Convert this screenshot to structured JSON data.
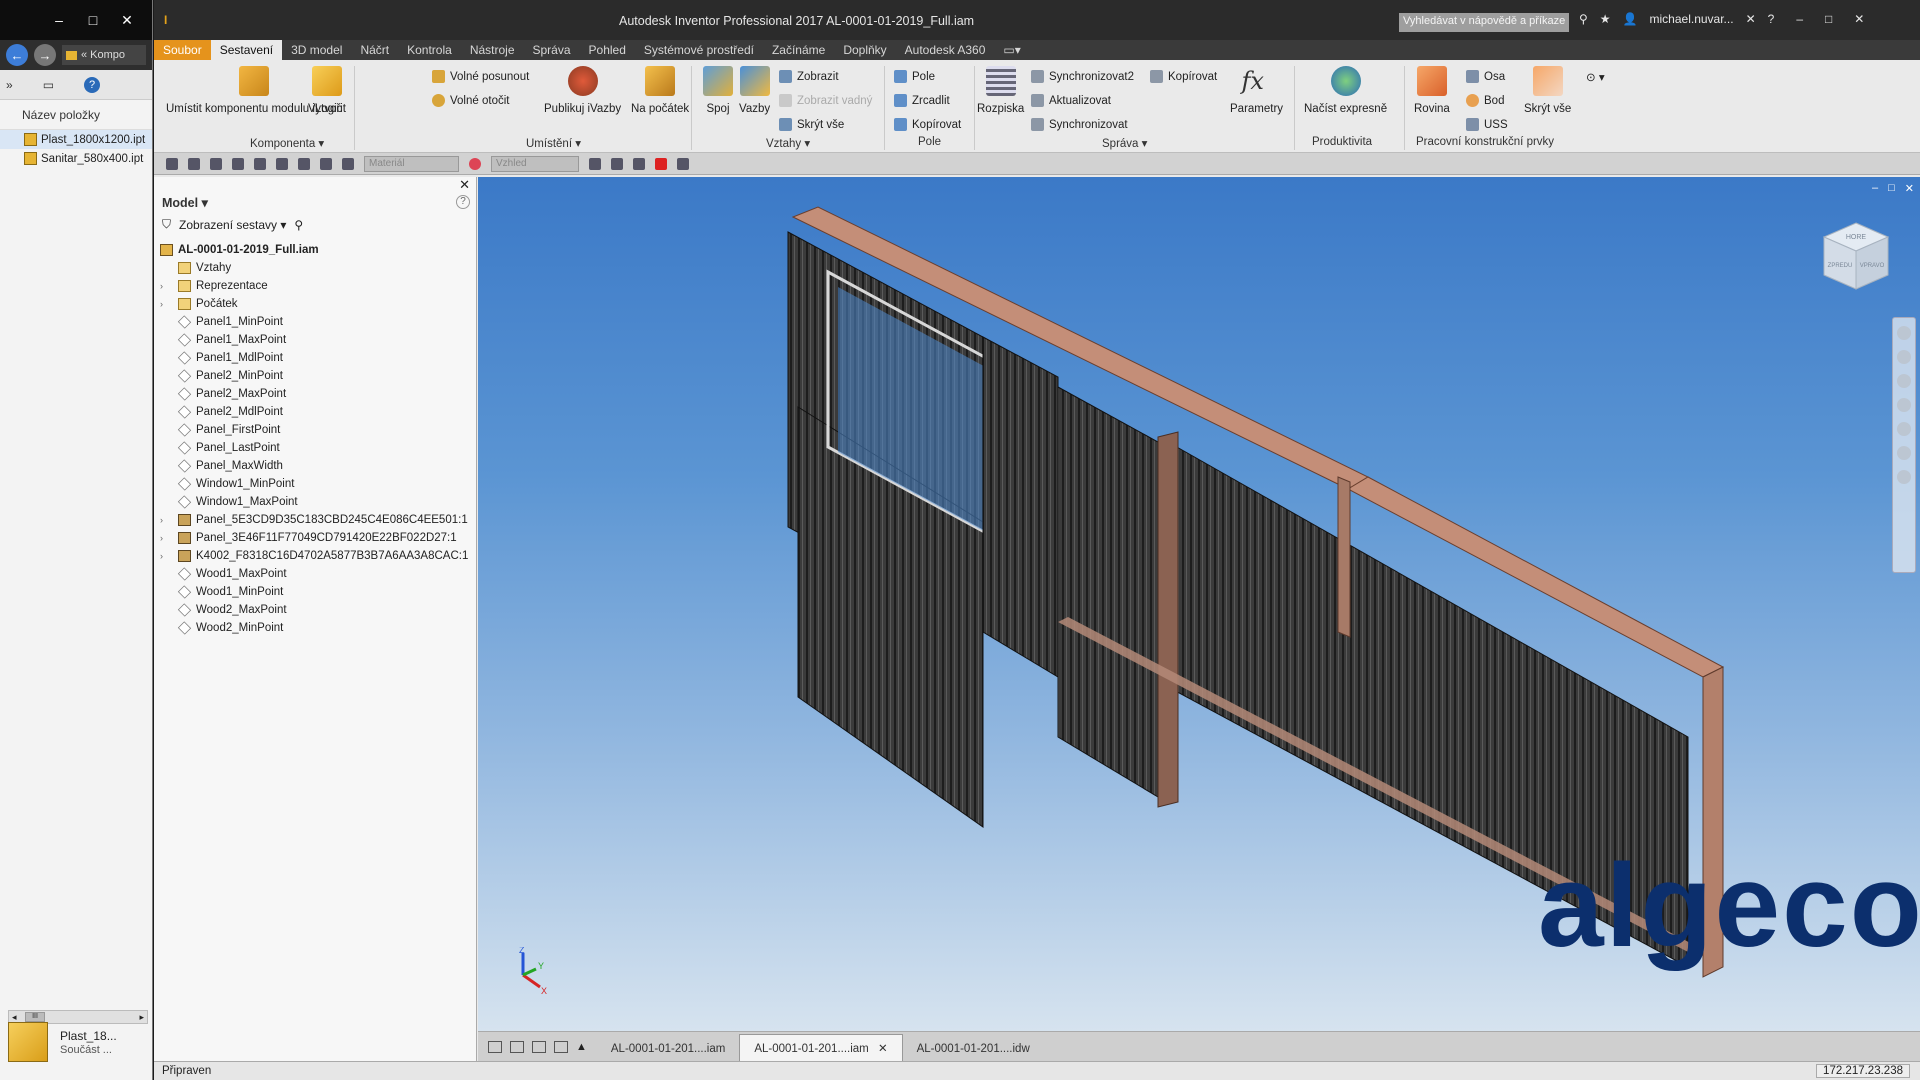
{
  "left_window": {
    "controls": [
      "–",
      "□",
      "✕"
    ],
    "address": "« Kompo",
    "column_header": "Název položky",
    "files": [
      "Plast_1800x1200.ipt",
      "Sanitar_580x400.ipt"
    ],
    "scroll_label": "III",
    "preview_name": "Plast_18...",
    "preview_sub": "Součást ..."
  },
  "titlebar": {
    "title": "Autodesk Inventor Professional 2017   AL-0001-01-2019_Full.iam",
    "search_placeholder": "Vyhledávat v nápovědě a příkaze",
    "user": "michael.nuvar...",
    "controls": [
      "–",
      "□",
      "✕"
    ]
  },
  "ribbon_tabs": [
    "Soubor",
    "Sestavení",
    "3D model",
    "Náčrt",
    "Kontrola",
    "Nástroje",
    "Správa",
    "Pohled",
    "Systémové prostředí",
    "Začínáme",
    "Doplňky",
    "Autodesk A360"
  ],
  "ribbon": {
    "komponenta": {
      "title": "Komponenta",
      "place_ilogic": "Umístit komponentu modulu iLogic",
      "create": "Vytvořit"
    },
    "umisteni": {
      "title": "Umístění",
      "free_move": "Volné posunout",
      "free_rotate": "Volné otočit",
      "publish": "Publikuj iVazby",
      "to_origin": "Na počátek"
    },
    "vztahy": {
      "title": "Vztahy",
      "joint": "Spoj",
      "constraint": "Vazby",
      "show": "Zobrazit",
      "show_sick": "Zobrazit vadný",
      "hide_all": "Skrýt vše"
    },
    "pole": {
      "title": "Pole",
      "pattern": "Pole",
      "mirror": "Zrcadlit",
      "copy": "Kopírovat"
    },
    "sprava": {
      "title": "Správa",
      "bom": "Rozpiska",
      "sync2": "Synchronizovat2",
      "update": "Aktualizovat",
      "sync": "Synchronizovat",
      "copy": "Kopírovat",
      "params": "Parametry"
    },
    "produktivita": {
      "title": "Produktivita",
      "load_express": "Načíst expresně"
    },
    "prvky": {
      "title": "Pracovní konstrukční prvky",
      "plane": "Rovina",
      "axis": "Osa",
      "point": "Bod",
      "ucs": "USS",
      "hide_all": "Skrýt vše"
    }
  },
  "qat": {
    "material": "Materiál",
    "appearance": "Vzhled"
  },
  "browser": {
    "title": "Model",
    "filter_label": "Zobrazení sestavy",
    "root": "AL-0001-01-2019_Full.iam",
    "nodes": [
      {
        "label": "Vztahy",
        "type": "folder",
        "expandable": false
      },
      {
        "label": "Reprezentace",
        "type": "folder",
        "expandable": true
      },
      {
        "label": "Počátek",
        "type": "folder",
        "expandable": true
      },
      {
        "label": "Panel1_MinPoint",
        "type": "wp",
        "expandable": false
      },
      {
        "label": "Panel1_MaxPoint",
        "type": "wp",
        "expandable": false
      },
      {
        "label": "Panel1_MdlPoint",
        "type": "wp",
        "expandable": false
      },
      {
        "label": "Panel2_MinPoint",
        "type": "wp",
        "expandable": false
      },
      {
        "label": "Panel2_MaxPoint",
        "type": "wp",
        "expandable": false
      },
      {
        "label": "Panel2_MdlPoint",
        "type": "wp",
        "expandable": false
      },
      {
        "label": "Panel_FirstPoint",
        "type": "wp",
        "expandable": false
      },
      {
        "label": "Panel_LastPoint",
        "type": "wp",
        "expandable": false
      },
      {
        "label": "Panel_MaxWidth",
        "type": "wp",
        "expandable": false
      },
      {
        "label": "Window1_MinPoint",
        "type": "wp",
        "expandable": false
      },
      {
        "label": "Window1_MaxPoint",
        "type": "wp",
        "expandable": false
      },
      {
        "label": "Panel_5E3CD9D35C183CBD245C4E086C4EE501:1",
        "type": "part",
        "expandable": true
      },
      {
        "label": "Panel_3E46F11F77049CD791420E22BF022D27:1",
        "type": "part",
        "expandable": true
      },
      {
        "label": "K4002_F8318C16D4702A5877B3B7A6AA3A8CAC:1",
        "type": "part",
        "expandable": true
      },
      {
        "label": "Wood1_MaxPoint",
        "type": "wp",
        "expandable": false
      },
      {
        "label": "Wood1_MinPoint",
        "type": "wp",
        "expandable": false
      },
      {
        "label": "Wood2_MaxPoint",
        "type": "wp",
        "expandable": false
      },
      {
        "label": "Wood2_MinPoint",
        "type": "wp",
        "expandable": false
      }
    ]
  },
  "viewport": {
    "watermark": "algeco",
    "watermark_reg": "®",
    "viewcube_top": "HORE",
    "viewcube_front": "ZPREDU",
    "viewcube_right": "VPRAVO",
    "triad": {
      "x": "X",
      "y": "Y",
      "z": "Z"
    },
    "controls": [
      "–",
      "□",
      "✕"
    ]
  },
  "doc_tabs": [
    "AL-0001-01-201....iam",
    "AL-0001-01-201....iam",
    "AL-0001-01-201....idw"
  ],
  "doc_tab_close": "✕",
  "status": {
    "text": "Připraven",
    "ip": "172.217.23.238"
  },
  "colors": {
    "file_tab": "#e5931c",
    "titlebar": "#2b2b2b",
    "viewport_top": "#3b79c7",
    "watermark": "#0c2f6d",
    "panel": "#3a3a3a",
    "frame": "#c08a74"
  }
}
